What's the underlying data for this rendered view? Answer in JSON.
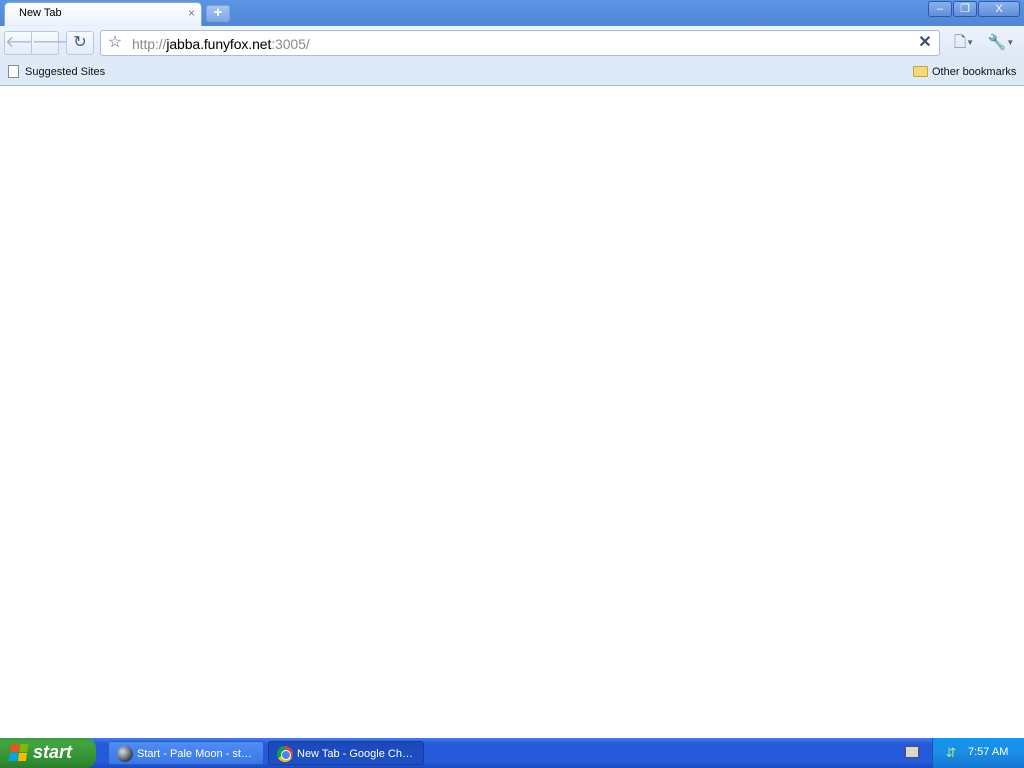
{
  "browser": {
    "tab": {
      "title": "New Tab",
      "close_glyph": "×"
    },
    "new_tab_glyph": "+",
    "window_controls": {
      "minimize": "‒",
      "maximize": "❐",
      "close": "X"
    },
    "nav": {
      "back_icon": "arrow-left",
      "forward_icon": "arrow-right",
      "reload_icon": "reload"
    },
    "omnibox": {
      "scheme": "http://",
      "host": "jabba.funyfox.net",
      "rest": ":3005/",
      "star_icon": "star",
      "stop_icon": "x"
    },
    "bookmarks_bar": {
      "items": [
        {
          "label": "Suggested Sites"
        }
      ],
      "other": "Other bookmarks"
    }
  },
  "taskbar": {
    "start_label": "start",
    "tasks": [
      {
        "label": "Start - Pale Moon - st…",
        "icon": "pale-moon-icon"
      },
      {
        "label": "New Tab - Google Ch…",
        "icon": "chrome-icon"
      }
    ],
    "clock": "7:57 AM"
  }
}
